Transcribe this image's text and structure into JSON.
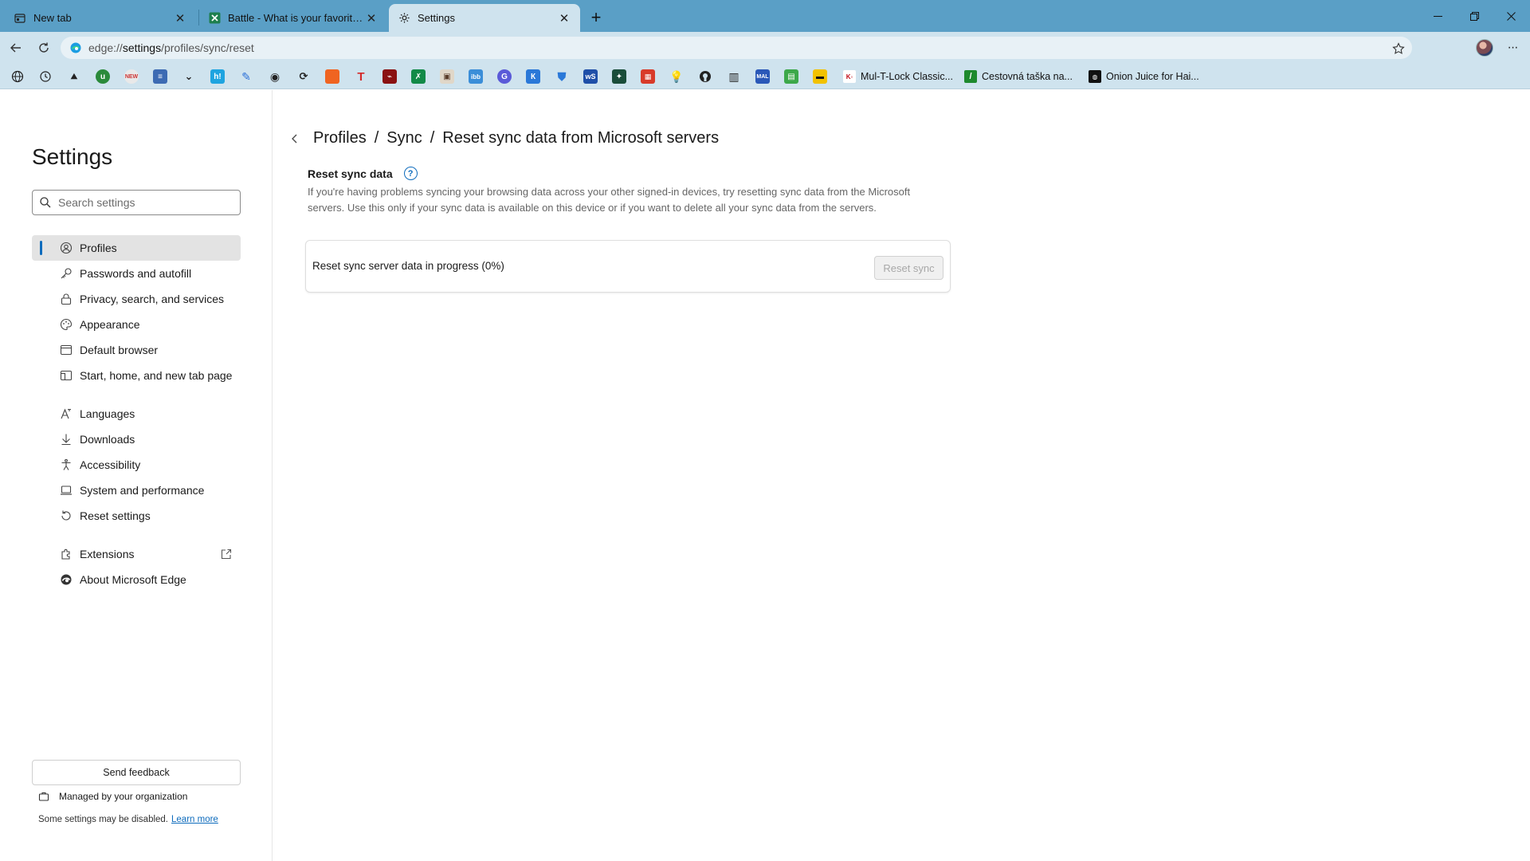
{
  "tabs": [
    {
      "title": "New tab",
      "icon": "newtab-page-icon"
    },
    {
      "title": "Battle - What is your favorite mobile",
      "icon": "spreadsheet-favicon"
    },
    {
      "title": "Settings",
      "icon": "gear-icon"
    }
  ],
  "address_bar": {
    "url_prefix": "edge://",
    "url_host": "settings",
    "url_path": "/profiles/sync/reset"
  },
  "favorites_bar": {
    "labeled": [
      {
        "label": "Mul-T-Lock Classic...",
        "icon": "multlock-favicon"
      },
      {
        "label": "Cestovná taška na...",
        "icon": "green-slash-favicon"
      },
      {
        "label": "Onion Juice for Hai...",
        "icon": "onion-favicon"
      }
    ]
  },
  "sidebar": {
    "title": "Settings",
    "search_placeholder": "Search settings",
    "items": [
      {
        "label": "Profiles",
        "icon": "profile-icon"
      },
      {
        "label": "Passwords and autofill",
        "icon": "key-icon"
      },
      {
        "label": "Privacy, search, and services",
        "icon": "lock-icon"
      },
      {
        "label": "Appearance",
        "icon": "palette-icon"
      },
      {
        "label": "Default browser",
        "icon": "browser-window-icon"
      },
      {
        "label": "Start, home, and new tab page",
        "icon": "home-icon"
      },
      {
        "label": "Languages",
        "icon": "languages-icon"
      },
      {
        "label": "Downloads",
        "icon": "download-icon"
      },
      {
        "label": "Accessibility",
        "icon": "accessibility-icon"
      },
      {
        "label": "System and performance",
        "icon": "laptop-icon"
      },
      {
        "label": "Reset settings",
        "icon": "reset-icon"
      },
      {
        "label": "Extensions",
        "icon": "puzzle-icon"
      },
      {
        "label": "About Microsoft Edge",
        "icon": "edge-logo-icon"
      }
    ],
    "feedback_label": "Send feedback",
    "managed_label": "Managed by your organization",
    "disabled_note": "Some settings may be disabled.",
    "learn_more": "Learn more"
  },
  "main": {
    "breadcrumb": [
      "Profiles",
      "Sync",
      "Reset sync data from Microsoft servers"
    ],
    "breadcrumb_sep": "/",
    "section_title": "Reset sync data",
    "description": "If you're having problems syncing your browsing data across your other signed-in devices, try resetting sync data from the Microsoft servers. Use this only if your sync data is available on this device or if you want to delete all your sync data from the servers.",
    "status_text": "Reset sync server data in progress (0%)",
    "progress_percent": 0,
    "reset_button": "Reset sync"
  },
  "colors": {
    "titlebar": "#5a9fc6",
    "toolbar": "#cfe3ee",
    "accent": "#0f6cbd"
  }
}
